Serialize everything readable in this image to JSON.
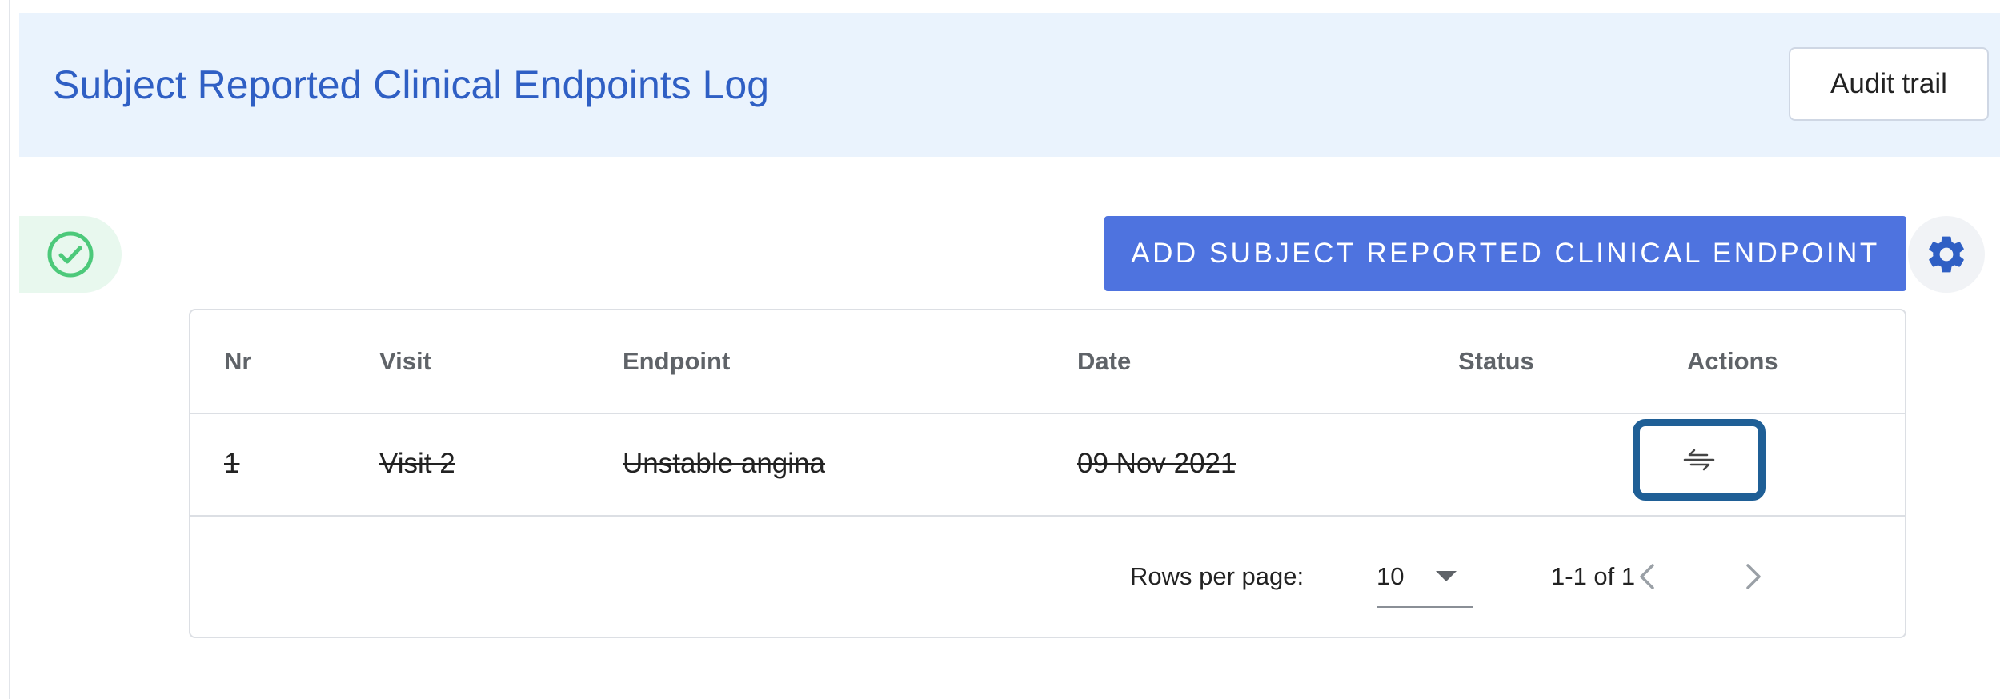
{
  "header": {
    "title": "Subject Reported Clinical Endpoints Log",
    "audit_button": "Audit trail"
  },
  "status_indicator": {
    "icon": "check-circle-icon",
    "color": "#4cc97a"
  },
  "toolbar": {
    "add_button": "ADD SUBJECT REPORTED CLINICAL ENDPOINT",
    "add_button_color": "#4e73df",
    "settings_icon": "gear-icon"
  },
  "table": {
    "columns": [
      "Nr",
      "Visit",
      "Endpoint",
      "Date",
      "Status",
      "Actions"
    ],
    "rows": [
      {
        "nr": "1",
        "visit": "Visit 2",
        "endpoint": "Unstable angina",
        "date": "09 Nov 2021",
        "status": "",
        "deleted": true,
        "action_icon": "restore-icon"
      }
    ]
  },
  "pagination": {
    "rows_per_page_label": "Rows per page:",
    "rows_per_page": "10",
    "range": "1-1 of 1"
  },
  "colors": {
    "accent": "#2f5fc4",
    "header_bg": "#eaf3fd",
    "highlight_border": "#1f5f96"
  }
}
